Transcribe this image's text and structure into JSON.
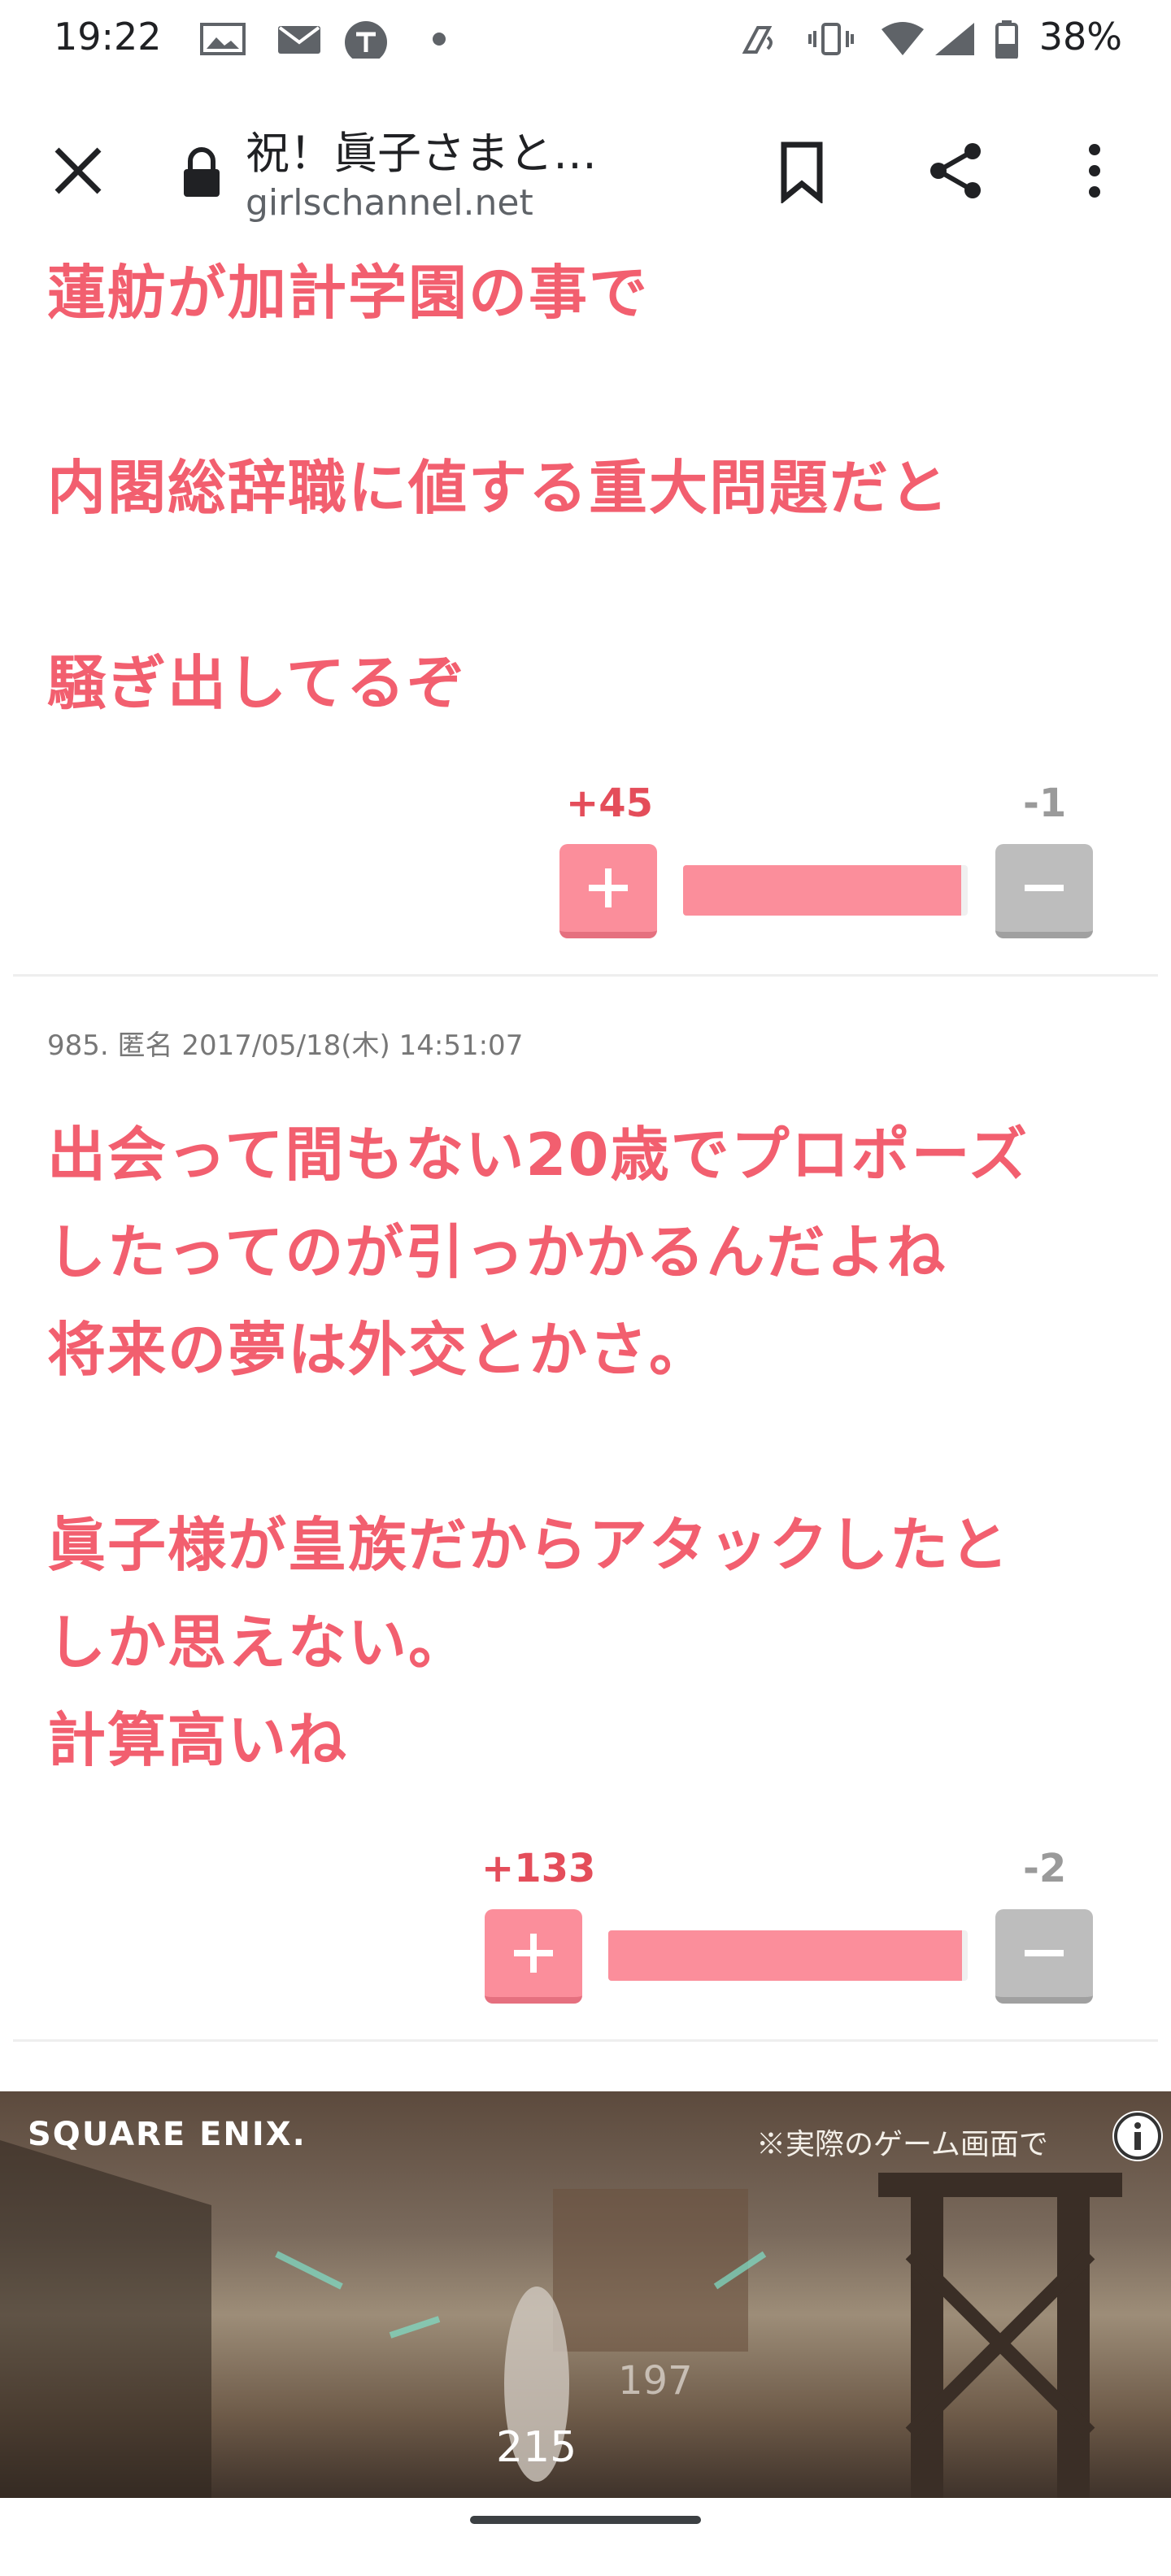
{
  "status_bar": {
    "time": "19:22",
    "battery": "38%",
    "icons": [
      "image-icon",
      "mail-icon",
      "app-icon",
      "dot-icon",
      "nfc-icon",
      "vibrate-icon",
      "wifi-icon",
      "signal-icon",
      "battery-icon"
    ]
  },
  "toolbar": {
    "title": "祝！眞子さまと…",
    "url": "girlschannel.net",
    "icons": [
      "close-icon",
      "lock-icon",
      "bookmark-icon",
      "share-icon",
      "more-icon"
    ]
  },
  "comments": [
    {
      "text": "蓮舫が加計学園の事で\n\n内閣総辞職に値する重大問題だと\n\n騒ぎ出してるぞ",
      "plus": "+45",
      "minus": "-1",
      "ratio": 0.978
    },
    {
      "meta": "985. 匿名 2017/05/18(木) 14:51:07",
      "text": "出会って間もない20歳でプロポーズ\nしたってのが引っかかるんだよね\n将来の夢は外交とかさ。\n\n眞子様が皇族だからアタックしたと\nしか思えない。\n計算高いね",
      "plus": "+133",
      "minus": "-2",
      "ratio": 0.985
    }
  ],
  "ad": {
    "logo": "SQUARE ENIX.",
    "caption": "※実際のゲーム画面で",
    "numbers": [
      "215",
      "197"
    ]
  },
  "colors": {
    "comment_text": "#f25f6f",
    "plus": "#fb8e9b",
    "minus": "#bdbdbd"
  }
}
